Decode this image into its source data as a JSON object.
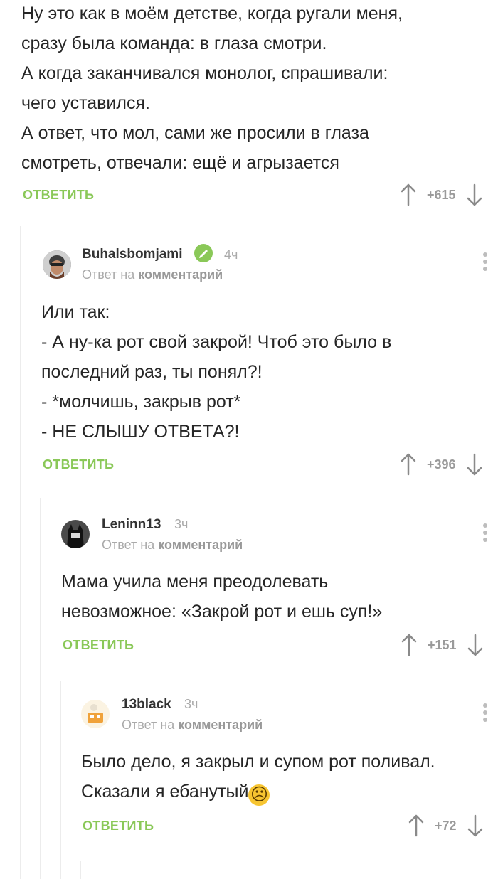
{
  "comments": [
    {
      "lines": [
        "Ну это как в моём детстве, когда ругали меня,",
        "сразу была команда: в глаза смотри.",
        "А когда заканчивался монолог, спрашивали:",
        "чего уставился.",
        "А ответ, что мол, сами же просили в глаза",
        "смотреть, отвечали: ещё и агрызается"
      ],
      "reply_label": "ОТВЕТИТЬ",
      "score": "+615"
    },
    {
      "author": "Buhalsbomjami",
      "time": "4ч",
      "reply_prefix": "Ответ на",
      "reply_target": "комментарий",
      "lines": [
        "Или так:",
        "- А ну-ка рот свой закрой! Чтоб это было в",
        "последний раз, ты понял?!",
        "- *молчишь, закрыв рот*",
        "- НЕ СЛЫШУ ОТВЕТА?!"
      ],
      "reply_label": "ОТВЕТИТЬ",
      "score": "+396"
    },
    {
      "author": "Leninn13",
      "time": "3ч",
      "reply_prefix": "Ответ на",
      "reply_target": "комментарий",
      "lines": [
        "Мама учила меня преодолевать",
        "невозможное: «Закрой рот и ешь суп!»"
      ],
      "reply_label": "ОТВЕТИТЬ",
      "score": "+151"
    },
    {
      "author": "13black",
      "time": "3ч",
      "reply_prefix": "Ответ на",
      "reply_target": "комментарий",
      "lines": [
        "Было дело, я закрыл и супом рот поливал.",
        "Сказали я ебанутый"
      ],
      "emoji": "☹",
      "reply_label": "ОТВЕТИТЬ",
      "score": "+72"
    }
  ],
  "colors": {
    "accent": "#8ac858",
    "muted": "#9a9a9a",
    "line": "#ececec"
  },
  "icons": [
    "upvote-arrow-icon",
    "downvote-arrow-icon",
    "more-vertical-icon",
    "verified-check-icon",
    "avatar"
  ]
}
